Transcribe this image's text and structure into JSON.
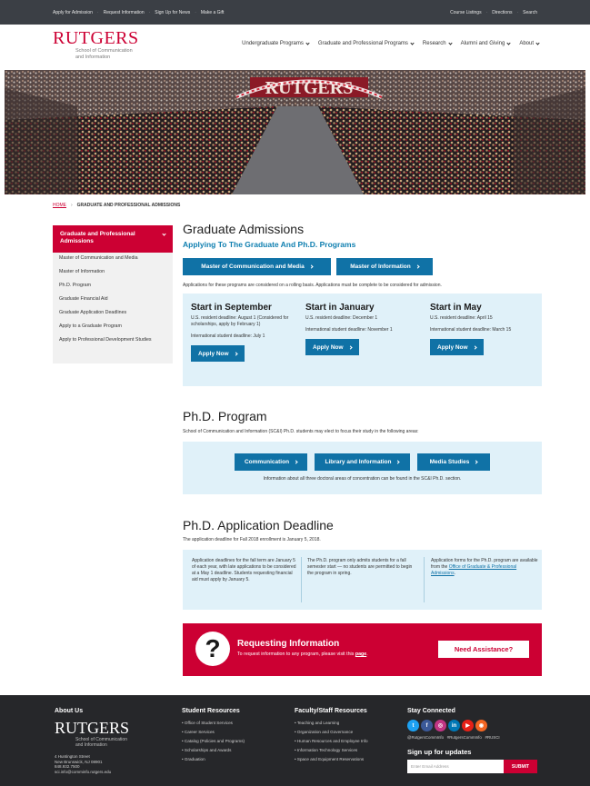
{
  "utility_bar": {
    "left_links": [
      "Apply for Admission",
      "Request Information",
      "Sign Up for News",
      "Make a Gift"
    ],
    "right_links": [
      "Course Listings",
      "Directions",
      "Search"
    ]
  },
  "header": {
    "logo_word": "RUTGERS",
    "logo_sub_line1": "School of Communication",
    "logo_sub_line2": "and Information",
    "nav": [
      "Undergraduate Programs",
      "Graduate and Professional Programs",
      "Research",
      "Alumni and Giving",
      "About"
    ]
  },
  "hero": {
    "banner_text": "RUTGERS"
  },
  "breadcrumb": {
    "home": "HOME",
    "current": "GRADUATE AND PROFESSIONAL ADMISSIONS"
  },
  "sidebar": {
    "heading": "Graduate and Professional Admissions",
    "items": [
      "Master of Communication and Media",
      "Master of Information",
      "Ph.D. Program",
      "Graduate Financial Aid",
      "Graduate Application Deadlines",
      "Apply to a Graduate Program",
      "Apply to Professional Development Studies"
    ]
  },
  "admissions": {
    "title": "Graduate Admissions",
    "subtitle": "Applying To The Graduate And Ph.D. Programs",
    "buttons": [
      "Master of Communication and Media",
      "Master of Information"
    ],
    "rolling_note": "Applications for these programs are considered on a rolling basis. Applications must be complete to be considered for admission.",
    "terms": [
      {
        "title": "Start in September",
        "us": "U.S. resident deadline: August 1 (Considered for scholarships, apply by February 1)",
        "intl": "International student deadline: July 1",
        "button": "Apply Now"
      },
      {
        "title": "Start in January",
        "us": "U.S. resident deadline: December 1",
        "intl": "International student deadline: November 1",
        "button": "Apply Now"
      },
      {
        "title": "Start in May",
        "us": "U.S. resident deadline: April 15",
        "intl": "International student deadline: March 15",
        "button": "Apply Now"
      }
    ]
  },
  "phd": {
    "title": "Ph.D. Program",
    "intro": "School of Communication and Information (SC&I) Ph.D. students may elect to focus their study in the following areas:",
    "buttons": [
      "Communication",
      "Library and Information",
      "Media Studies"
    ],
    "note": "Information about all three doctoral areas of concentration can be found in the SC&I Ph.D. section."
  },
  "phd_deadline": {
    "title": "Ph.D. Application Deadline",
    "intro": "The application deadline for Fall 2018 enrollment is January 5, 2018.",
    "col1": "Application deadlines for the fall term are January 5 of each year, with late applications to be considered at a May 1 deadline. Students requesting financial aid must apply by January 5.",
    "col2": "The Ph.D. program only admits students for a fall semester start — no students are permitted to begin the program in spring.",
    "col3_pre": "Application forms for the Ph.D. program are available from the ",
    "col3_link": "Office of Graduate & Professional Admissions",
    "col3_post": "."
  },
  "request_info": {
    "title": "Requesting Information",
    "text_pre": "To request information to any program, please visit this ",
    "link": "page",
    "text_post": ".",
    "button": "Need Assistance?"
  },
  "footer": {
    "about": {
      "heading": "About Us",
      "logo_word": "RUTGERS",
      "logo_sub_line1": "School of Communication",
      "logo_sub_line2": "and Information",
      "address": [
        "4 Huntington Street",
        "New Brunswick, NJ 08901",
        "848.932.7500",
        "sci.info@comminfo.rutgers.edu"
      ]
    },
    "students": {
      "heading": "Student Resources",
      "items": [
        "Office of Student Services",
        "Career Services",
        "Catalog (Policies and Programs)",
        "Scholarships and Awards",
        "Graduation"
      ]
    },
    "faculty": {
      "heading": "Faculty/Staff Resources",
      "items": [
        "Teaching and Learning",
        "Organization and Governance",
        "Human Resources and Employee Info",
        "Information Technology Services",
        "Space and Equipment Reservations"
      ]
    },
    "connect": {
      "heading": "Stay Connected",
      "social_icons": [
        "twitter-icon",
        "facebook-icon",
        "instagram-icon",
        "linkedin-icon",
        "youtube-icon",
        "rss-icon"
      ],
      "handles": [
        "@RutgersCommInfo",
        "#RutgersCommInfo",
        "#RUSCI"
      ],
      "signup_title": "Sign up for updates",
      "email_placeholder": "Enter Email Address",
      "submit": "SUBMIT"
    }
  },
  "colors": {
    "scarlet": "#cc0033",
    "blue": "#1072a6",
    "light_blue": "#e0f1f9",
    "footer": "#26272a"
  }
}
